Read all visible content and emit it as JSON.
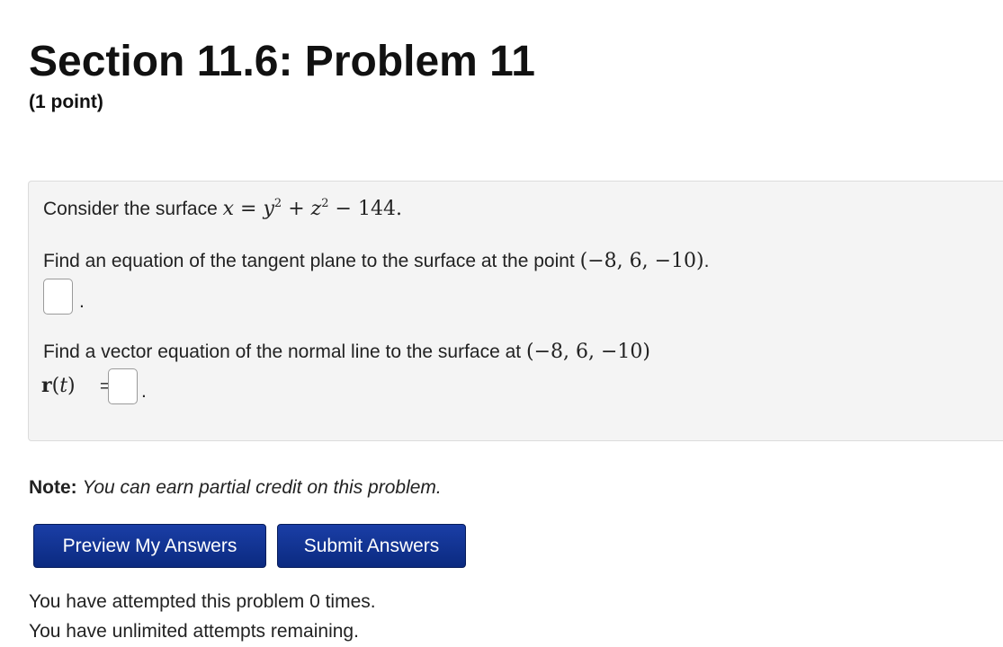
{
  "header": {
    "title": "Section 11.6: Problem 11",
    "points": "(1 point)"
  },
  "problem": {
    "intro_text": "Consider the surface",
    "surface_equation": {
      "lhs": "x",
      "equals": "=",
      "y": "y",
      "exp1": "2",
      "plus": "+",
      "z": "z",
      "exp2": "2",
      "minus": "−",
      "constant": "144."
    },
    "tangent_question": "Find an equation of the tangent plane to the surface at the point",
    "point": "(−8, 6, −10)",
    "point_punct": ".",
    "answer1_suffix": ".",
    "normal_question": "Find a vector equation of the normal line to the surface at",
    "point_2": "(−8, 6, −10)",
    "rt_label": {
      "r": "r",
      "open": "(",
      "t": "t",
      "close": ")",
      "equals": "="
    },
    "answer2_suffix": "."
  },
  "note": {
    "label": "Note:",
    "text": "You can earn partial credit on this problem."
  },
  "buttons": {
    "preview": "Preview My Answers",
    "submit": "Submit Answers"
  },
  "status": {
    "attempted": "You have attempted this problem 0 times.",
    "remaining": "You have unlimited attempts remaining."
  }
}
